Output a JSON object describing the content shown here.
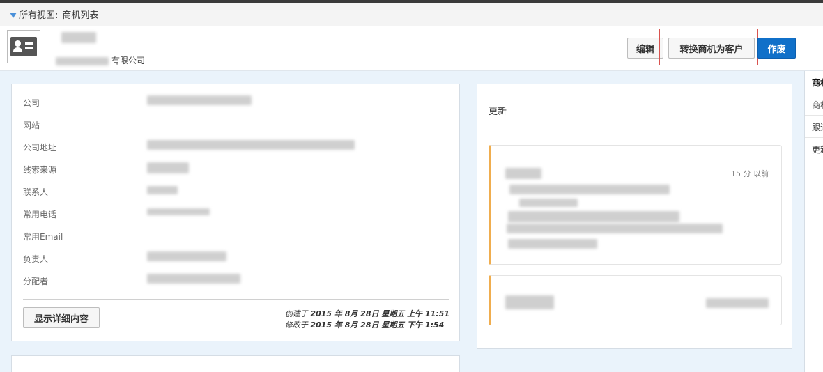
{
  "breadcrumb": {
    "label": "所有视图:",
    "current": "商机列表"
  },
  "header": {
    "company_suffix": "有限公司"
  },
  "buttons": {
    "edit": "编辑",
    "convert": "转换商机为客户",
    "void": "作废",
    "show_details": "显示详细内容"
  },
  "fields": [
    {
      "label": "公司"
    },
    {
      "label": "网站"
    },
    {
      "label": "公司地址"
    },
    {
      "label": "线索来源"
    },
    {
      "label": "联系人"
    },
    {
      "label": "常用电话"
    },
    {
      "label": "常用Email"
    },
    {
      "label": "负责人"
    },
    {
      "label": "分配者"
    }
  ],
  "timestamps": {
    "created_prefix": "创建于",
    "created_value": "2015 年 8月 28日 星期五 上午 11:51",
    "modified_prefix": "修改于",
    "modified_value": "2015 年 8月 28日 星期五 下午 1:54"
  },
  "updates": {
    "title": "更新",
    "items": [
      {
        "time": "15 分 以前"
      }
    ]
  },
  "side_tabs": [
    {
      "label": "商机"
    },
    {
      "label": "商机"
    },
    {
      "label": "跟进"
    },
    {
      "label": "更新"
    }
  ],
  "colors": {
    "accent": "#1070c9",
    "update_bar": "#f0ad4e",
    "highlight": "#d9534f"
  },
  "icons": {
    "filter": "filter-icon",
    "avatar": "contact-card-icon"
  }
}
